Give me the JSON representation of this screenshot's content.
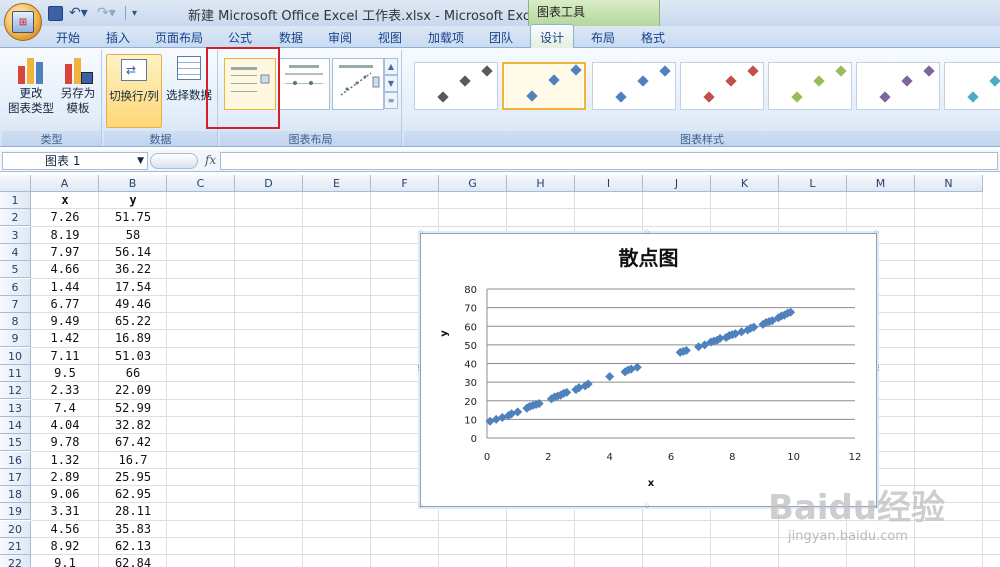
{
  "window": {
    "title": "新建 Microsoft Office Excel 工作表.xlsx - Microsoft Excel",
    "contextual_group": "图表工具"
  },
  "ribbon_tabs": [
    "开始",
    "插入",
    "页面布局",
    "公式",
    "数据",
    "审阅",
    "视图",
    "加载项",
    "团队",
    "设计",
    "布局",
    "格式"
  ],
  "active_tab": "设计",
  "ribbon": {
    "type_group": {
      "label": "类型",
      "change_type": "更改\n图表类型",
      "save_template": "另存为\n模板"
    },
    "data_group": {
      "label": "数据",
      "switch_row_col": "切换行/列",
      "select_data": "选择数据"
    },
    "layout_group": {
      "label": "图表布局"
    },
    "styles_group": {
      "label": "图表样式"
    }
  },
  "formula_bar": {
    "name_box": "图表 1",
    "fx": "fx",
    "formula": ""
  },
  "columns": [
    "A",
    "B",
    "C",
    "D",
    "E",
    "F",
    "G",
    "H",
    "I",
    "J",
    "K",
    "L",
    "M",
    "N"
  ],
  "rows": [
    "1",
    "2",
    "3",
    "4",
    "5",
    "6",
    "7",
    "8",
    "9",
    "10",
    "11",
    "12",
    "13",
    "14",
    "15",
    "16",
    "17",
    "18",
    "19",
    "20",
    "21",
    "22"
  ],
  "table": {
    "headers": [
      "x",
      "y"
    ],
    "data": [
      [
        "7.26",
        "51.75"
      ],
      [
        "8.19",
        "58"
      ],
      [
        "7.97",
        "56.14"
      ],
      [
        "4.66",
        "36.22"
      ],
      [
        "1.44",
        "17.54"
      ],
      [
        "6.77",
        "49.46"
      ],
      [
        "9.49",
        "65.22"
      ],
      [
        "1.42",
        "16.89"
      ],
      [
        "7.11",
        "51.03"
      ],
      [
        "9.5",
        "66"
      ],
      [
        "2.33",
        "22.09"
      ],
      [
        "7.4",
        "52.99"
      ],
      [
        "4.04",
        "32.82"
      ],
      [
        "9.78",
        "67.42"
      ],
      [
        "1.32",
        "16.7"
      ],
      [
        "2.89",
        "25.95"
      ],
      [
        "9.06",
        "62.95"
      ],
      [
        "3.31",
        "28.11"
      ],
      [
        "4.56",
        "35.83"
      ],
      [
        "8.92",
        "62.13"
      ],
      [
        "9.1",
        "62.84"
      ]
    ]
  },
  "chart_data": {
    "type": "scatter",
    "title": "散点图",
    "xlabel": "x",
    "ylabel": "y",
    "xlim": [
      0,
      12
    ],
    "ylim": [
      0,
      80
    ],
    "x_ticks": [
      0,
      2,
      4,
      6,
      8,
      10,
      12
    ],
    "y_ticks": [
      0,
      10,
      20,
      30,
      40,
      50,
      60,
      70,
      80
    ],
    "grid": "horizontal",
    "marker_color": "#4f81bd",
    "series": [
      {
        "x": [
          0.1,
          0.3,
          0.5,
          0.7,
          0.8,
          1.0,
          1.3,
          1.4,
          1.5,
          1.6,
          1.7,
          2.1,
          2.2,
          2.3,
          2.4,
          2.5,
          2.6,
          2.9,
          3.0,
          3.2,
          3.3,
          4.0,
          4.5,
          4.6,
          4.7,
          4.9,
          6.3,
          6.4,
          6.5,
          6.9,
          7.1,
          7.3,
          7.4,
          7.5,
          7.6,
          7.8,
          7.9,
          8.0,
          8.1,
          8.3,
          8.5,
          8.6,
          8.7,
          9.0,
          9.1,
          9.2,
          9.3,
          9.5,
          9.6,
          9.7,
          9.8,
          9.9
        ],
        "y": [
          9,
          10,
          11,
          12,
          13,
          14,
          16,
          17,
          17.5,
          18,
          18.5,
          21,
          22,
          22.5,
          23,
          24,
          24.5,
          26,
          27,
          28,
          29,
          33,
          35.5,
          36.5,
          37,
          38,
          46,
          46.5,
          47,
          49,
          50,
          51.5,
          52,
          52.5,
          53.5,
          54,
          55,
          55.5,
          56,
          57,
          58,
          59,
          59.5,
          61,
          62,
          62.5,
          63,
          64.5,
          65.5,
          66,
          67,
          67.5
        ]
      }
    ]
  },
  "watermark": {
    "brand": "Baidu经验",
    "url": "jingyan.baidu.com"
  }
}
